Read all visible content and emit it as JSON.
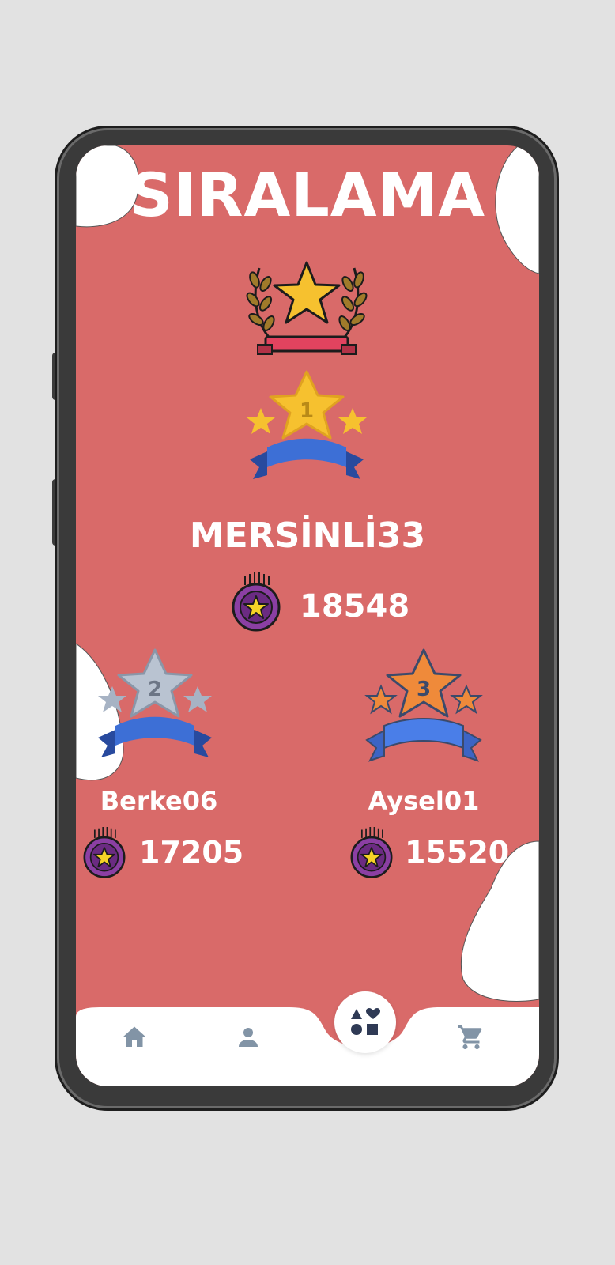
{
  "page": {
    "title": "SIRALAMA"
  },
  "podium": {
    "first": {
      "rank": "1",
      "name": "MERSİNLİ33",
      "score": "18548"
    },
    "second": {
      "rank": "2",
      "name": "Berke06",
      "score": "17205"
    },
    "third": {
      "rank": "3",
      "name": "Aysel01",
      "score": "15520"
    }
  },
  "icons": {
    "trophy": "laurel-star-icon",
    "coin": "star-coin-icon",
    "home": "home-icon",
    "profile": "person-icon",
    "center": "shapes-icon",
    "cart": "cart-icon"
  },
  "colors": {
    "background": "#d96a69",
    "gold": "#f6c12f",
    "silver": "#a7b3c4",
    "bronze": "#ef8a3a",
    "ribbon": "#3d6fd6",
    "nav_icon": "#8294a6",
    "fab_icon": "#2f3a55"
  }
}
